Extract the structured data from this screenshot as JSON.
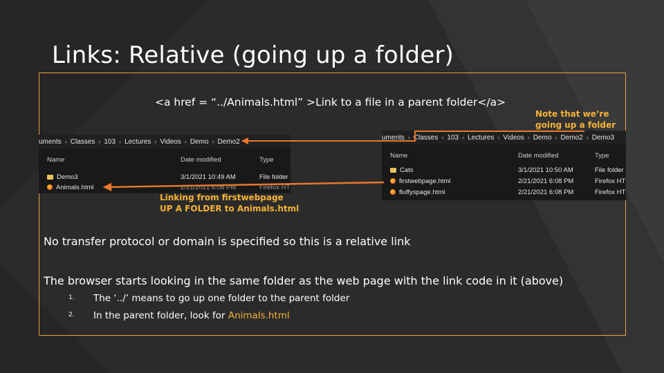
{
  "title": "Links: Relative (going up a folder)",
  "code_line": "<a href = “../Animals.html” >Link to a file in a parent folder</a>",
  "note": "Note that we’re going up a folder here",
  "linking_line1": "Linking from firstwebpage",
  "linking_line2": "UP A FOLDER to Animals.html",
  "paragraph1": "No transfer protocol or domain is specified so this is a relative link",
  "paragraph2": "The browser starts looking in the same folder as the web page with the link code in it (above)",
  "list": [
    {
      "num": "1.",
      "text": "The ‘../’ means to go up one folder to the parent folder",
      "prefix": "",
      "highlight": ""
    },
    {
      "num": "2.",
      "text": "",
      "prefix": "In the parent folder, look for ",
      "highlight": "Animals.html"
    }
  ],
  "colors": {
    "accent": "#f5b335",
    "frame": "#e8a33d",
    "arrow": "#e8772e"
  },
  "explorer_left": {
    "crumbs": [
      "uments",
      "Classes",
      "103",
      "Lectures",
      "Videos",
      "Demo",
      "Demo2"
    ],
    "headers": {
      "name": "Name",
      "date": "Date modified",
      "type": "Type"
    },
    "rows": [
      {
        "icon": "folder-icon",
        "name": "Demo3",
        "date": "3/1/2021 10:49 AM",
        "type": "File folder"
      },
      {
        "icon": "firefox-icon",
        "name": "Animals.html",
        "date": "2/21/2021 6:08 PM",
        "type": "Firefox HTI"
      }
    ]
  },
  "explorer_right": {
    "crumbs": [
      "uments",
      "Classes",
      "103",
      "Lectures",
      "Videos",
      "Demo",
      "Demo2",
      "Demo3"
    ],
    "headers": {
      "name": "Name",
      "date": "Date modified",
      "type": "Type"
    },
    "rows": [
      {
        "icon": "folder-icon",
        "name": "Cats",
        "date": "3/1/2021 10:50 AM",
        "type": "File folder"
      },
      {
        "icon": "firefox-icon",
        "name": "firstwebpage.html",
        "date": "2/21/2021 6:08 PM",
        "type": "Firefox HTN"
      },
      {
        "icon": "firefox-icon",
        "name": "fluffyspage.html",
        "date": "2/21/2021 6:08 PM",
        "type": "Firefox HTN"
      }
    ]
  }
}
